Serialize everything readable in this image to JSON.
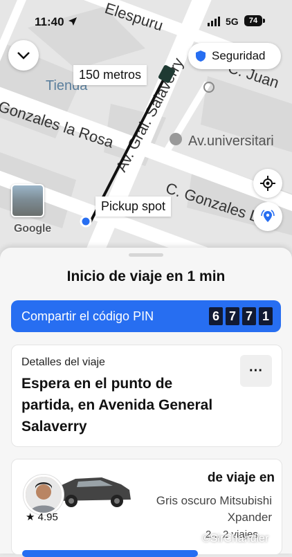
{
  "status": {
    "time": "11:40",
    "network": "5G",
    "battery": "74"
  },
  "map": {
    "streets": [
      "Elespuru",
      "Av. Gral. Salaverry",
      "C. Juan",
      "Gonzales la Rosa",
      "C. Gonzales La"
    ],
    "poi_1": "Tienda",
    "poi_2": "Av.universitari",
    "distance_tag": "150 metros",
    "pickup_tag": "Pickup spot",
    "google": "Google",
    "security_label": "Seguridad"
  },
  "sheet": {
    "title": "Inicio de viaje en 1 min",
    "pin_label": "Compartir el código PIN",
    "pin_digits": [
      "6",
      "7",
      "7",
      "1"
    ],
    "details_label": "Detalles del viaje",
    "details_text": "Espera en el punto de partida, en Avenida General Salaverry",
    "more_label": "···",
    "driver": {
      "rating": "★ 4.95",
      "trip_heading": "de viaje en",
      "car_model": "Gris oscuro Mitsubishi Xpander",
      "stats": "2... 2 viajes"
    }
  },
  "watermark": "©SirChandler",
  "colors": {
    "accent": "#276ef1",
    "route": "#111111",
    "pickup_dot": "#276ef1"
  }
}
